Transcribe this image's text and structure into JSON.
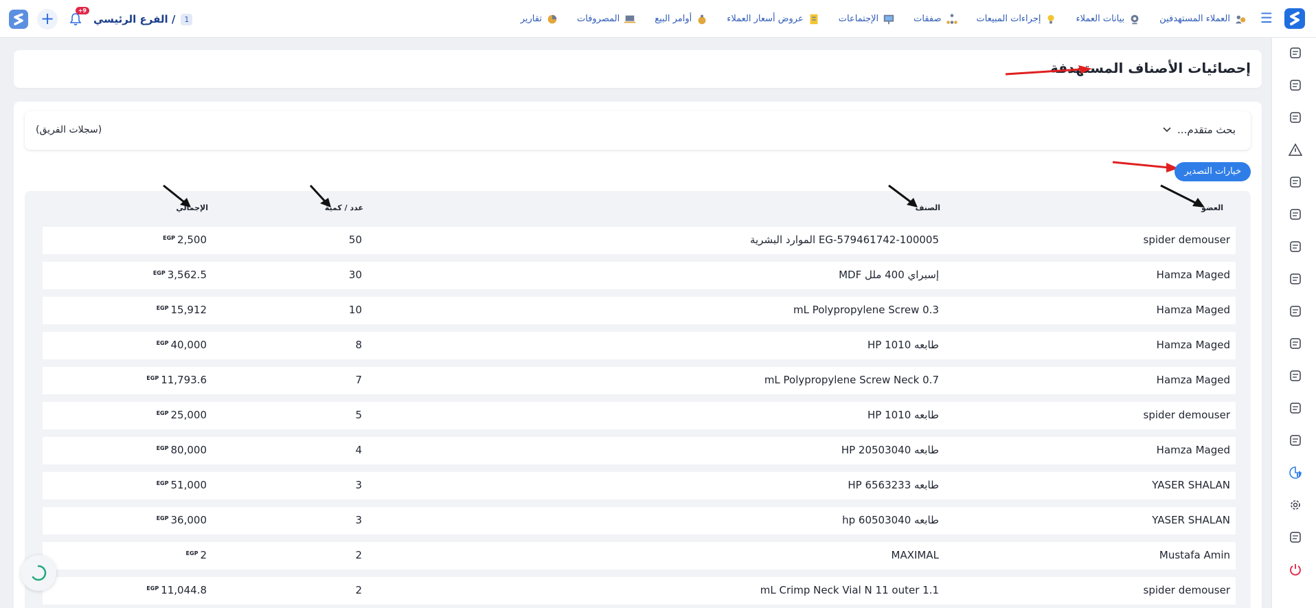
{
  "topbar": {
    "branch_number": "1",
    "branch_label": "الفرع الرئيسي /",
    "notification_badge": "+9",
    "nav": [
      {
        "label": "العملاء المستهدفين",
        "icon": "users-target-icon"
      },
      {
        "label": "بيانات العملاء",
        "icon": "webcam-icon"
      },
      {
        "label": "إجراءات المبيعات",
        "icon": "bulb-icon"
      },
      {
        "label": "صفقات",
        "icon": "org-chart-icon"
      },
      {
        "label": "الإجتماعات",
        "icon": "presentation-icon"
      },
      {
        "label": "عروض أسعار العملاء",
        "icon": "document-icon"
      },
      {
        "label": "أوامر البيع",
        "icon": "money-bag-icon"
      },
      {
        "label": "المصروفات",
        "icon": "laptop-icon"
      },
      {
        "label": "تقارير",
        "icon": "pie-chart-icon"
      }
    ]
  },
  "page": {
    "title": "إحصائيات الأصناف المستهدفة",
    "advanced_search": "بحث متقدم...",
    "team_logs": "(سجلات الفريق)",
    "export_button": "خيارات التصدير"
  },
  "table": {
    "headers": {
      "member": "العضو",
      "item": "الصنف",
      "qty": "عدد / كمية",
      "total": "الإجمالي"
    },
    "currency": "EGP",
    "rows": [
      {
        "member": "spider demouser",
        "item": "EG-579461742-100005 الموارد البشرية",
        "qty": "50",
        "total": "2,500"
      },
      {
        "member": "Hamza Maged",
        "item": "إسبراي 400 ملل MDF",
        "qty": "30",
        "total": "3,562.5"
      },
      {
        "member": "Hamza Maged",
        "item": "mL Polypropylene Screw 0.3",
        "qty": "10",
        "total": "15,912"
      },
      {
        "member": "Hamza Maged",
        "item": "طابعه HP 1010",
        "qty": "8",
        "total": "40,000"
      },
      {
        "member": "Hamza Maged",
        "item": "mL Polypropylene Screw Neck 0.7",
        "qty": "7",
        "total": "11,793.6"
      },
      {
        "member": "spider demouser",
        "item": "طابعه HP 1010",
        "qty": "5",
        "total": "25,000"
      },
      {
        "member": "Hamza Maged",
        "item": "طابعه HP 20503040",
        "qty": "4",
        "total": "80,000"
      },
      {
        "member": "YASER SHALAN",
        "item": "طابعه HP 6563233",
        "qty": "3",
        "total": "51,000"
      },
      {
        "member": "YASER SHALAN",
        "item": "طابعه hp 60503040",
        "qty": "3",
        "total": "36,000"
      },
      {
        "member": "Mustafa Amin",
        "item": "MAXIMAL",
        "qty": "2",
        "total": "2"
      },
      {
        "member": "spider demouser",
        "item": "mL Crimp Neck Vial N 11 outer 1.1",
        "qty": "2",
        "total": "11,044.8"
      }
    ]
  },
  "sidebar_icons": [
    "settings-file-icon",
    "team-icon",
    "money-icon",
    "warning-icon",
    "video-icon",
    "chart-triangle-icon",
    "invoice-icon",
    "pen-icon",
    "delivery-icon",
    "boxes-icon",
    "support-icon",
    "file-add-icon",
    "file-search-icon",
    "analytics-icon",
    "gear-icon",
    "window-icon",
    "power-icon"
  ],
  "colors": {
    "accent": "#2f7ee8",
    "nav": "#2f5bb8",
    "arrow_red": "#e02020",
    "arrow_black": "#111111"
  }
}
